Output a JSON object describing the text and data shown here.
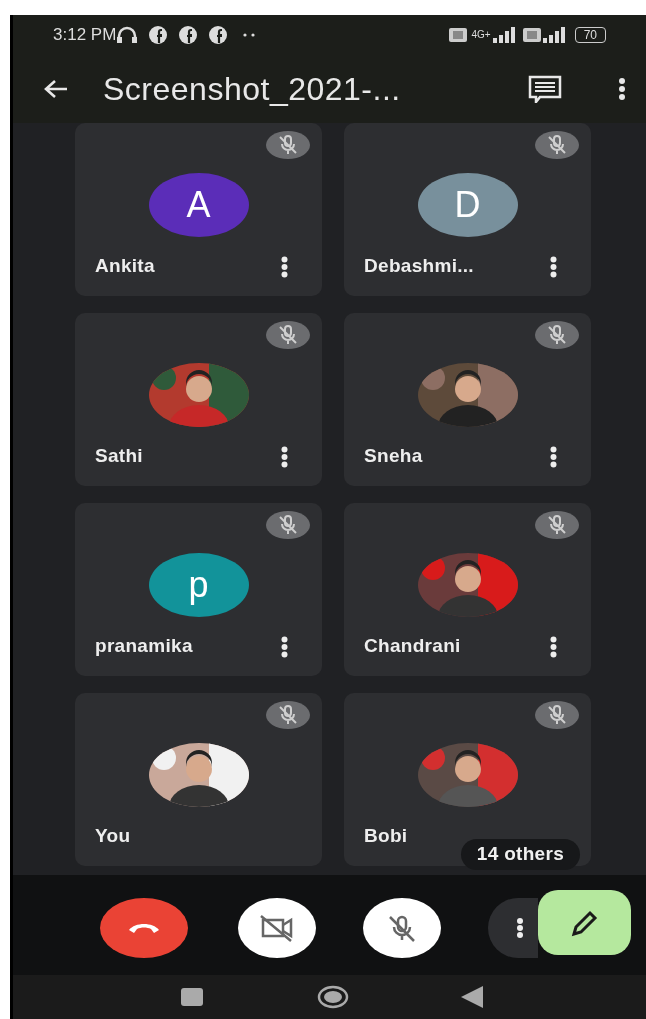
{
  "status_bar": {
    "time": "3:12 PM",
    "network": "4G+",
    "battery": "70"
  },
  "app_bar": {
    "title": "Screenshot_2021-..."
  },
  "participants": [
    {
      "name": "Ankita",
      "avatar": {
        "kind": "initial",
        "letter": "A",
        "color": "#5b2db8"
      },
      "muted": true,
      "menu": true
    },
    {
      "name": "Debashmi...",
      "avatar": {
        "kind": "initial",
        "letter": "D",
        "color": "#78909c"
      },
      "muted": true,
      "menu": true
    },
    {
      "name": "Sathi",
      "muted": true,
      "menu": true
    },
    {
      "name": "Sneha",
      "muted": true,
      "menu": true
    },
    {
      "name": "pranamika",
      "avatar": {
        "kind": "initial",
        "letter": "p",
        "color": "#12939a"
      },
      "muted": true,
      "menu": true
    },
    {
      "name": "Chandrani",
      "muted": true,
      "menu": true
    },
    {
      "name": "You",
      "muted": true,
      "menu": false
    },
    {
      "name": "Bobi",
      "muted": true,
      "menu": false
    }
  ],
  "others_chip": "14 others"
}
